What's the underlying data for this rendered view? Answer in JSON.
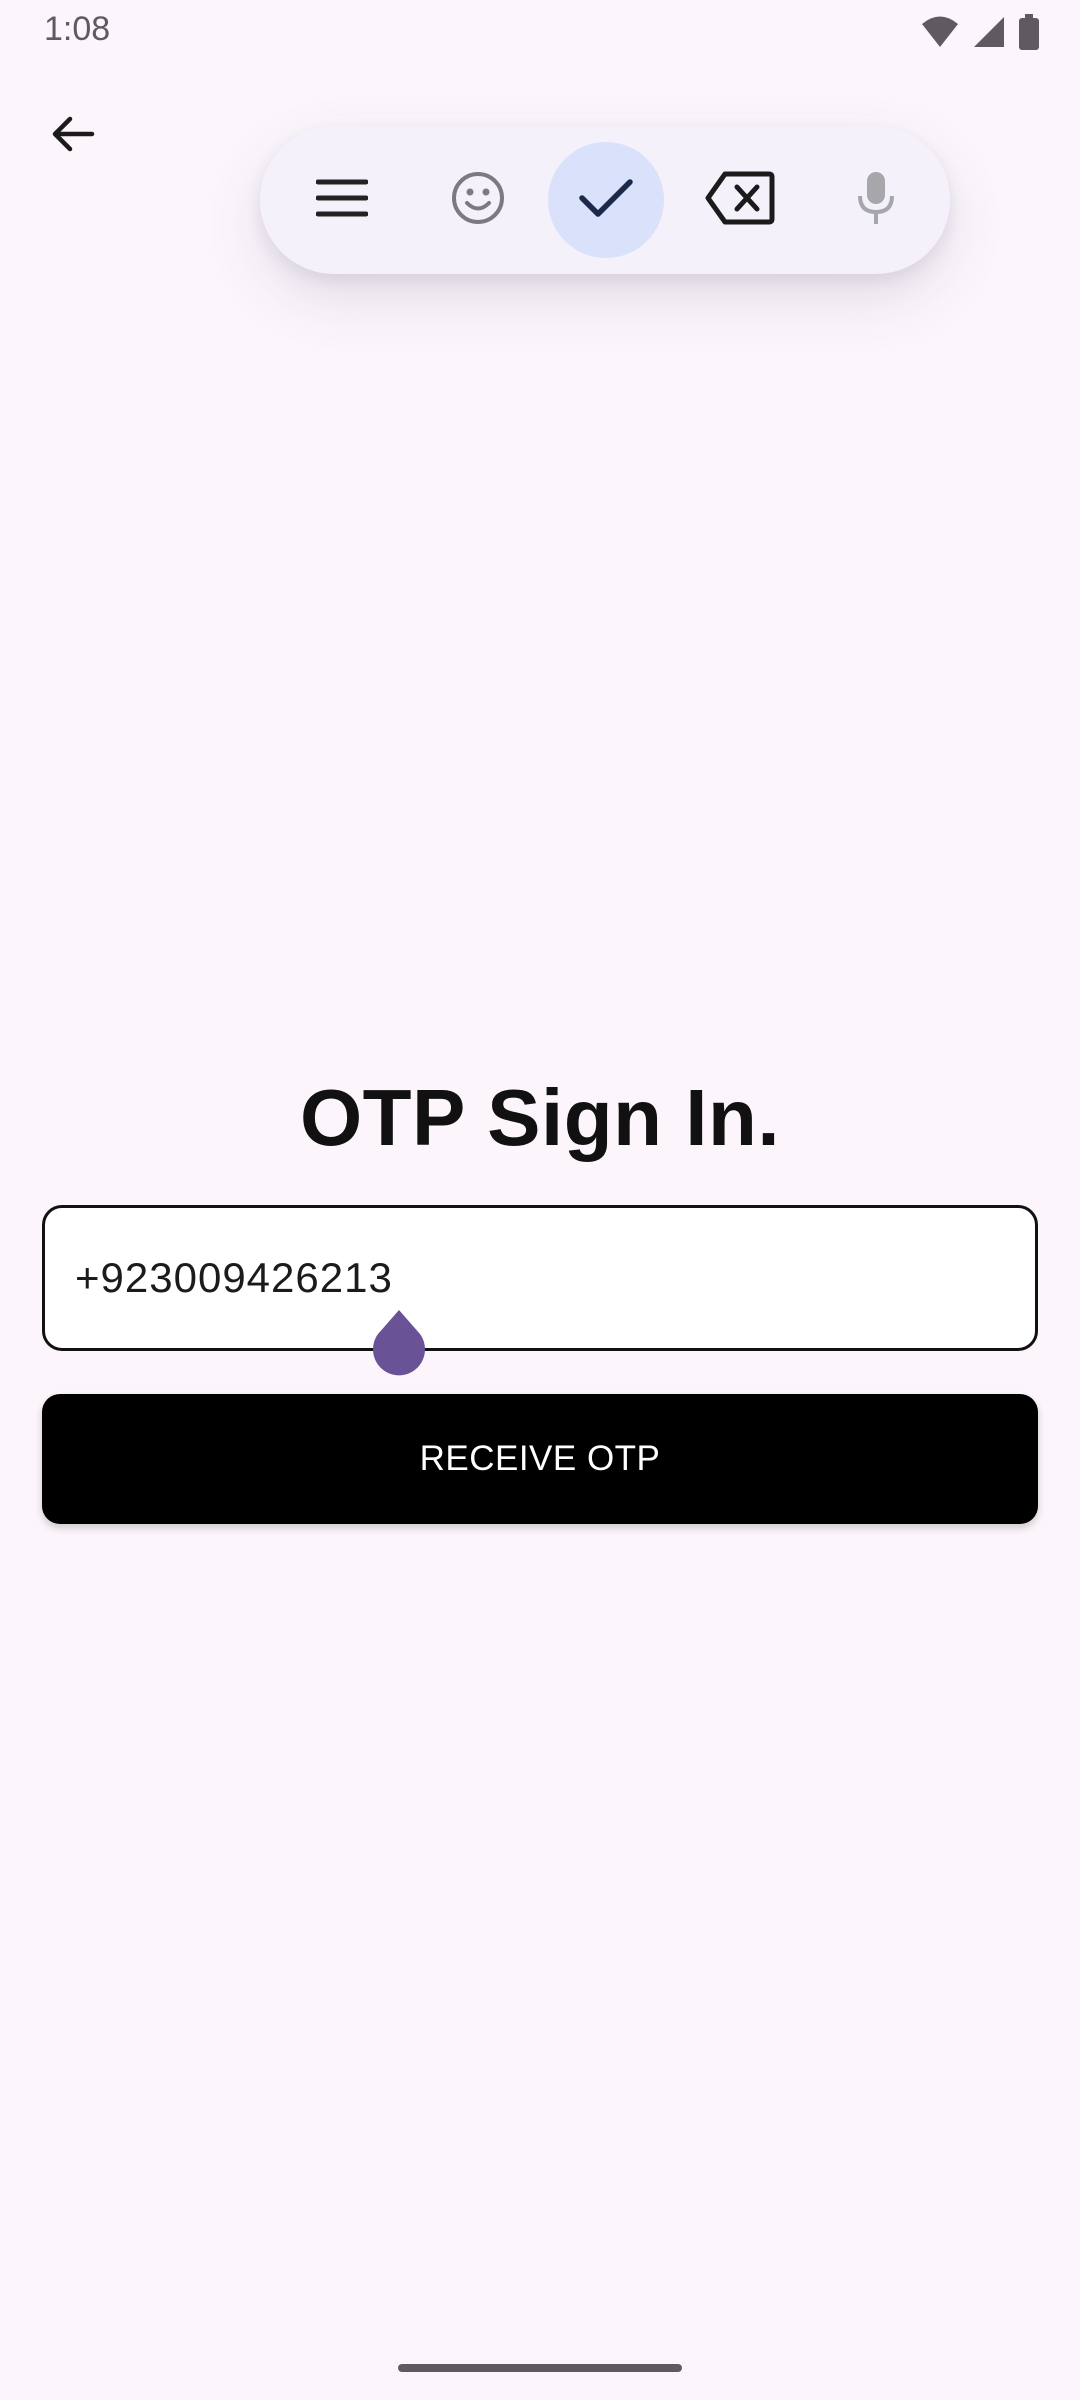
{
  "status_bar": {
    "time": "1:08",
    "icons": [
      "wifi-icon",
      "signal-icon",
      "battery-icon"
    ]
  },
  "nav": {
    "back_icon": "back-arrow-icon"
  },
  "keyboard_toolbar": {
    "buttons": [
      "menu-icon",
      "emoji-icon",
      "check-icon",
      "backspace-icon",
      "mic-icon"
    ],
    "active_color": "#d9e1fb"
  },
  "main": {
    "title": "OTP Sign In.",
    "phone_field": {
      "value": "+923009426213"
    },
    "receive_button": {
      "label": "RECEIVE OTP"
    }
  },
  "colors": {
    "background": "#fcf6fc",
    "cursor_handle": "#6a5296",
    "button": "#000000"
  }
}
